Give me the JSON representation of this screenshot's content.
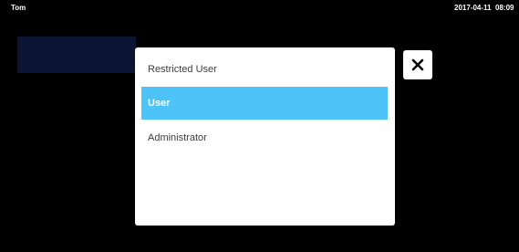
{
  "status_bar": {
    "user": "Tom",
    "date": "2017-04-11",
    "time": "08:09"
  },
  "user_role_dialog": {
    "options": [
      {
        "label": "Restricted User",
        "selected": false
      },
      {
        "label": "User",
        "selected": true
      },
      {
        "label": "Administrator",
        "selected": false
      }
    ],
    "selected_color": "#4dc3f7"
  },
  "close_button": {
    "icon": "close-icon"
  }
}
